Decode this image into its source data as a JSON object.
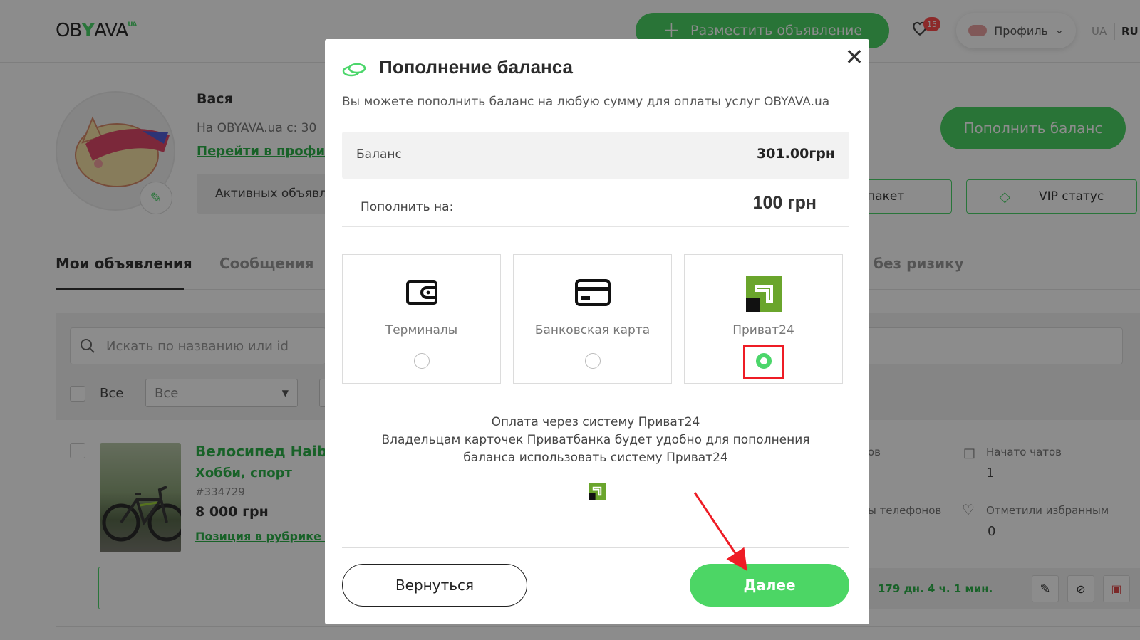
{
  "header": {
    "logo_text": "OBYAVA",
    "logo_sup": "UA",
    "post_ad_label": "Разместить объявление",
    "favorites_count": "15",
    "profile_label": "Профиль",
    "lang_ua": "UA",
    "lang_ru": "RU"
  },
  "profile": {
    "name": "Вася",
    "since": "На OBYAVA.ua с: 30",
    "goto_link": "Перейти в профил",
    "active_ads": "Активных объявл",
    "topup_button": "Пополнить баланс",
    "package_button": "-пакет",
    "vip_button": "VIP статус",
    "rn_text": "н"
  },
  "tabs": {
    "my_ads": "Мои объявления",
    "messages": "Сообщения",
    "no_risk": "без ризику"
  },
  "filters": {
    "search_placeholder": "Искать по названию или id",
    "all_label": "Все",
    "select_value": "Все"
  },
  "ad": {
    "title": "Велосипед Haibi",
    "category": "Хобби, спорт",
    "id": "#334729",
    "price": "8 000 грн",
    "position_link": "Позиция в рубрике",
    "stat_views_lbl": "ов",
    "stat_chats_lbl": "Начато чатов",
    "stat_chats_val": "1",
    "stat_phones_lbl": "ы телефонов",
    "stat_fav_lbl": "Отметили избранным",
    "stat_fav_val": "0",
    "timer": "179 дн. 4 ч. 1 мин."
  },
  "modal": {
    "title": "Пополнение баланса",
    "subtitle": "Вы можете пополнить баланс на любую сумму для оплаты услуг OBYAVA.ua",
    "balance_label": "Баланс",
    "balance_value": "301.00грн",
    "amount_label": "Пополнить на:",
    "amount_value": "100 грн",
    "methods": [
      {
        "label": "Терминалы",
        "icon": "wallet-icon",
        "selected": false
      },
      {
        "label": "Банковская карта",
        "icon": "credit-card-icon",
        "selected": false
      },
      {
        "label": "Приват24",
        "icon": "privat24-logo-icon",
        "selected": true
      }
    ],
    "desc_line1": "Оплата через систему Приват24",
    "desc_line2": "Владельцам карточек Приватбанка будет удобно для пополнения",
    "desc_line3": "баланса использовать систему Приват24",
    "back_button": "Вернуться",
    "next_button": "Далее"
  },
  "colors": {
    "accent_green": "#4cd665",
    "link_green": "#2db24a",
    "highlight_red": "#ee1c25",
    "privat_green": "#6aa52c"
  }
}
